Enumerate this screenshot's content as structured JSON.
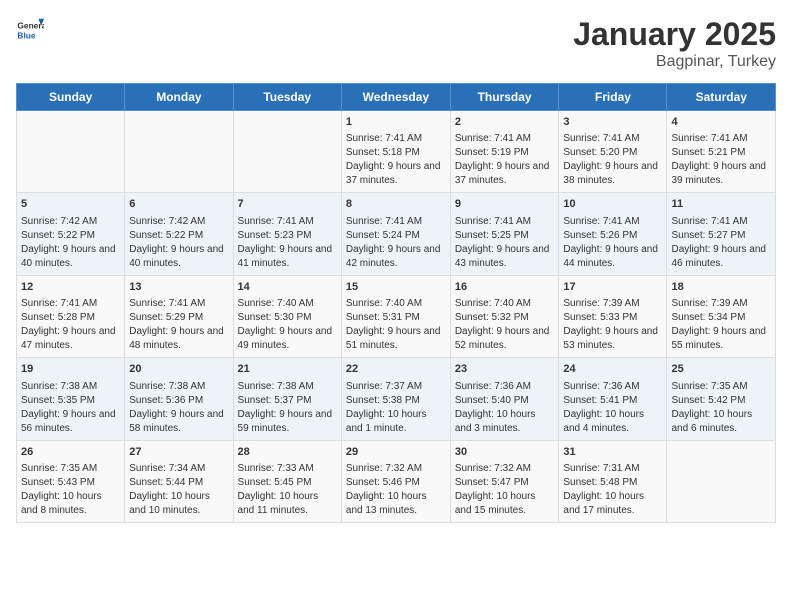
{
  "header": {
    "logo_general": "General",
    "logo_blue": "Blue",
    "title": "January 2025",
    "subtitle": "Bagpinar, Turkey"
  },
  "weekdays": [
    "Sunday",
    "Monday",
    "Tuesday",
    "Wednesday",
    "Thursday",
    "Friday",
    "Saturday"
  ],
  "weeks": [
    [
      {
        "day": "",
        "content": ""
      },
      {
        "day": "",
        "content": ""
      },
      {
        "day": "",
        "content": ""
      },
      {
        "day": "1",
        "content": "Sunrise: 7:41 AM\nSunset: 5:18 PM\nDaylight: 9 hours and 37 minutes."
      },
      {
        "day": "2",
        "content": "Sunrise: 7:41 AM\nSunset: 5:19 PM\nDaylight: 9 hours and 37 minutes."
      },
      {
        "day": "3",
        "content": "Sunrise: 7:41 AM\nSunset: 5:20 PM\nDaylight: 9 hours and 38 minutes."
      },
      {
        "day": "4",
        "content": "Sunrise: 7:41 AM\nSunset: 5:21 PM\nDaylight: 9 hours and 39 minutes."
      }
    ],
    [
      {
        "day": "5",
        "content": "Sunrise: 7:42 AM\nSunset: 5:22 PM\nDaylight: 9 hours and 40 minutes."
      },
      {
        "day": "6",
        "content": "Sunrise: 7:42 AM\nSunset: 5:22 PM\nDaylight: 9 hours and 40 minutes."
      },
      {
        "day": "7",
        "content": "Sunrise: 7:41 AM\nSunset: 5:23 PM\nDaylight: 9 hours and 41 minutes."
      },
      {
        "day": "8",
        "content": "Sunrise: 7:41 AM\nSunset: 5:24 PM\nDaylight: 9 hours and 42 minutes."
      },
      {
        "day": "9",
        "content": "Sunrise: 7:41 AM\nSunset: 5:25 PM\nDaylight: 9 hours and 43 minutes."
      },
      {
        "day": "10",
        "content": "Sunrise: 7:41 AM\nSunset: 5:26 PM\nDaylight: 9 hours and 44 minutes."
      },
      {
        "day": "11",
        "content": "Sunrise: 7:41 AM\nSunset: 5:27 PM\nDaylight: 9 hours and 46 minutes."
      }
    ],
    [
      {
        "day": "12",
        "content": "Sunrise: 7:41 AM\nSunset: 5:28 PM\nDaylight: 9 hours and 47 minutes."
      },
      {
        "day": "13",
        "content": "Sunrise: 7:41 AM\nSunset: 5:29 PM\nDaylight: 9 hours and 48 minutes."
      },
      {
        "day": "14",
        "content": "Sunrise: 7:40 AM\nSunset: 5:30 PM\nDaylight: 9 hours and 49 minutes."
      },
      {
        "day": "15",
        "content": "Sunrise: 7:40 AM\nSunset: 5:31 PM\nDaylight: 9 hours and 51 minutes."
      },
      {
        "day": "16",
        "content": "Sunrise: 7:40 AM\nSunset: 5:32 PM\nDaylight: 9 hours and 52 minutes."
      },
      {
        "day": "17",
        "content": "Sunrise: 7:39 AM\nSunset: 5:33 PM\nDaylight: 9 hours and 53 minutes."
      },
      {
        "day": "18",
        "content": "Sunrise: 7:39 AM\nSunset: 5:34 PM\nDaylight: 9 hours and 55 minutes."
      }
    ],
    [
      {
        "day": "19",
        "content": "Sunrise: 7:38 AM\nSunset: 5:35 PM\nDaylight: 9 hours and 56 minutes."
      },
      {
        "day": "20",
        "content": "Sunrise: 7:38 AM\nSunset: 5:36 PM\nDaylight: 9 hours and 58 minutes."
      },
      {
        "day": "21",
        "content": "Sunrise: 7:38 AM\nSunset: 5:37 PM\nDaylight: 9 hours and 59 minutes."
      },
      {
        "day": "22",
        "content": "Sunrise: 7:37 AM\nSunset: 5:38 PM\nDaylight: 10 hours and 1 minute."
      },
      {
        "day": "23",
        "content": "Sunrise: 7:36 AM\nSunset: 5:40 PM\nDaylight: 10 hours and 3 minutes."
      },
      {
        "day": "24",
        "content": "Sunrise: 7:36 AM\nSunset: 5:41 PM\nDaylight: 10 hours and 4 minutes."
      },
      {
        "day": "25",
        "content": "Sunrise: 7:35 AM\nSunset: 5:42 PM\nDaylight: 10 hours and 6 minutes."
      }
    ],
    [
      {
        "day": "26",
        "content": "Sunrise: 7:35 AM\nSunset: 5:43 PM\nDaylight: 10 hours and 8 minutes."
      },
      {
        "day": "27",
        "content": "Sunrise: 7:34 AM\nSunset: 5:44 PM\nDaylight: 10 hours and 10 minutes."
      },
      {
        "day": "28",
        "content": "Sunrise: 7:33 AM\nSunset: 5:45 PM\nDaylight: 10 hours and 11 minutes."
      },
      {
        "day": "29",
        "content": "Sunrise: 7:32 AM\nSunset: 5:46 PM\nDaylight: 10 hours and 13 minutes."
      },
      {
        "day": "30",
        "content": "Sunrise: 7:32 AM\nSunset: 5:47 PM\nDaylight: 10 hours and 15 minutes."
      },
      {
        "day": "31",
        "content": "Sunrise: 7:31 AM\nSunset: 5:48 PM\nDaylight: 10 hours and 17 minutes."
      },
      {
        "day": "",
        "content": ""
      }
    ]
  ]
}
